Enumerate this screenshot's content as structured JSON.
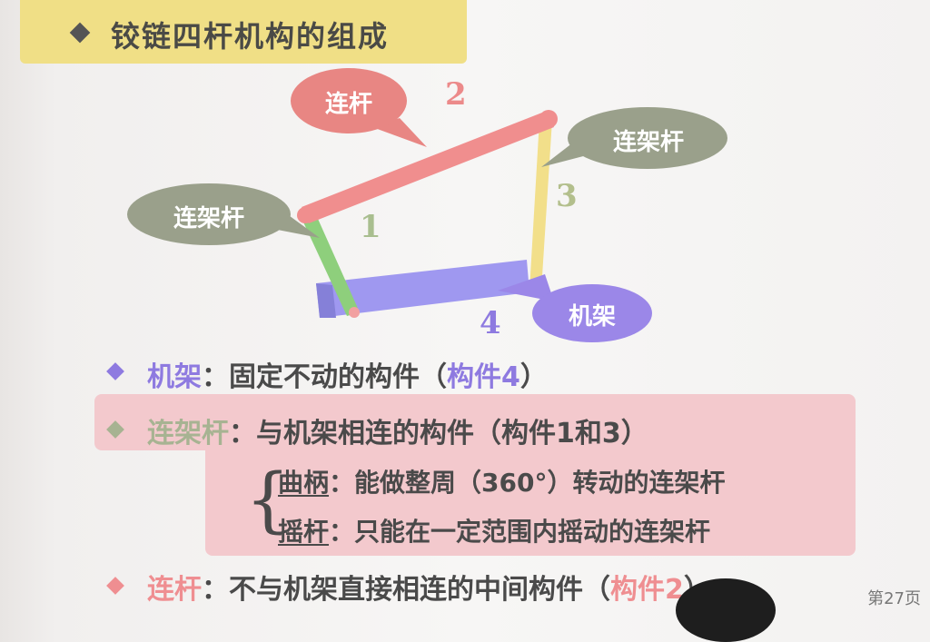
{
  "title": "铰链四杆机构的组成",
  "diagram": {
    "bubble_coupler": "连杆",
    "bubble_side_left": "连架杆",
    "bubble_side_right": "连架杆",
    "bubble_frame": "机架",
    "num_1": "1",
    "num_2": "2",
    "num_3": "3",
    "num_4": "4"
  },
  "bullets": {
    "frame": {
      "term": "机架",
      "text": "：固定不动的构件（",
      "ref": "构件4",
      "end": "）"
    },
    "side": {
      "term": "连架杆",
      "text": "：与机架相连的构件（构件1和3）"
    },
    "crank": {
      "term": "曲柄",
      "text": "：能做整周（360°）转动的连架杆"
    },
    "rocker": {
      "term": "摇杆",
      "text": "：只能在一定范围内摇动的连架杆"
    },
    "coupler": {
      "term": "连杆",
      "text": "：不与机架直接相连的中间构件（",
      "ref": "构件2",
      "end": "）"
    }
  },
  "page_number": "第27页",
  "colors": {
    "title_bg": "#f0df86",
    "link_1": "#8ecf7c",
    "link_2": "#f08e8e",
    "link_3": "#f2df8a",
    "frame": "#9f98f0",
    "bubble_green": "#9aa08b",
    "bubble_red": "#e88683",
    "bubble_purple": "#9b87e8"
  }
}
